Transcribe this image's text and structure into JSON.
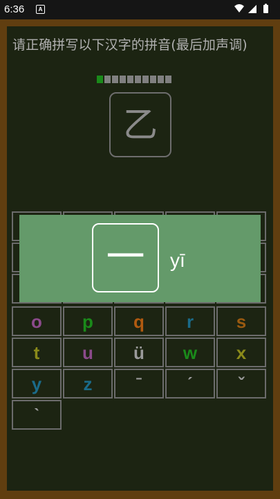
{
  "status_bar": {
    "time": "6:36",
    "notification_icon": "A",
    "icons": [
      "wifi-icon",
      "signal-icon",
      "battery-icon"
    ]
  },
  "prompt": "请正确拼写以下汉字的拼音(最后加声调)",
  "progress": {
    "completed": 1,
    "total": 10
  },
  "character": "乙",
  "popup": {
    "hanzi": "一",
    "pinyin": "yī"
  },
  "keyboard": {
    "rows": [
      [
        {
          "label": "o",
          "color": "#8b4a8b"
        },
        {
          "label": "p",
          "color": "#1a8a1a"
        },
        {
          "label": "q",
          "color": "#b05a10"
        },
        {
          "label": "r",
          "color": "#1a6b8a"
        },
        {
          "label": "s",
          "color": "#9a5a10"
        }
      ],
      [
        {
          "label": "t",
          "color": "#8a8a1a"
        },
        {
          "label": "u",
          "color": "#8b4a8b"
        },
        {
          "label": "ü",
          "color": "#9a9a9a"
        },
        {
          "label": "w",
          "color": "#1a8a1a"
        },
        {
          "label": "x",
          "color": "#8a8a1a"
        }
      ],
      [
        {
          "label": "y",
          "color": "#1a6b8a"
        },
        {
          "label": "z",
          "color": "#1a6b8a"
        },
        {
          "label": "ˉ",
          "color": "#9a9a9a"
        },
        {
          "label": "ˊ",
          "color": "#9a9a9a"
        },
        {
          "label": "ˇ",
          "color": "#9a9a9a"
        }
      ],
      [
        {
          "label": "ˋ",
          "color": "#9a9a9a"
        }
      ]
    ]
  }
}
